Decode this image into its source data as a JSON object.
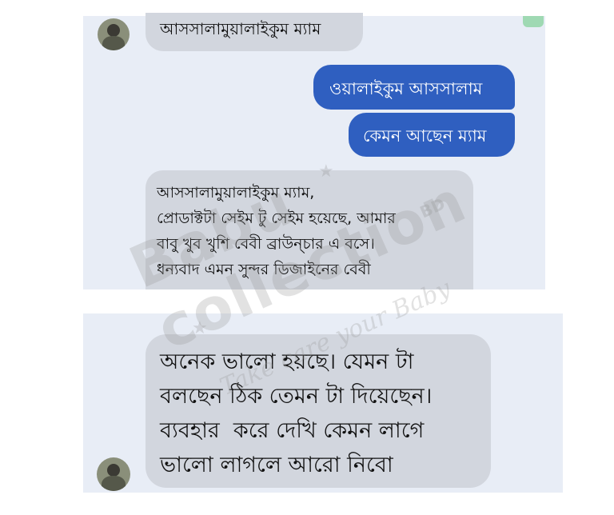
{
  "chat": {
    "messages": [
      {
        "from": "customer",
        "text": "আসসালামুয়ালাইকুম ম্যাম"
      },
      {
        "from": "seller",
        "text": "ওয়ালাইকুম আসসালাম"
      },
      {
        "from": "seller",
        "text": "কেমন আছেন ম্যাম"
      },
      {
        "from": "customer",
        "lines": [
          "আসসালামুয়ালাইকুম ম্যাম,",
          "প্রোডাক্টটা সেইম টু সেইম হয়েছে, আমার",
          "বাবু খুব খুশি বেবী ব্রাউন্চার এ বসে।",
          "ধন্যবাদ এমন সুন্দর ডিজাইনের বেবী"
        ]
      },
      {
        "from": "customer",
        "lines": [
          "অনেক ভালো হয়ছে। যেমন টা",
          "বলছেন ঠিক তেমন টা দিয়েছেন।",
          "ব্যবহার  করে দেখি কেমন লাগে",
          "ভালো লাগলে আরো নিবো"
        ]
      }
    ]
  },
  "watermark": {
    "brand": "Babu collection",
    "suffix": "BD",
    "tagline": "Take care your Baby"
  },
  "colors": {
    "panel": "#e8edf6",
    "incoming_bubble": "#d2d6de",
    "outgoing_bubble": "#2f5fc0"
  },
  "icons": [
    "avatar",
    "star-icon"
  ]
}
